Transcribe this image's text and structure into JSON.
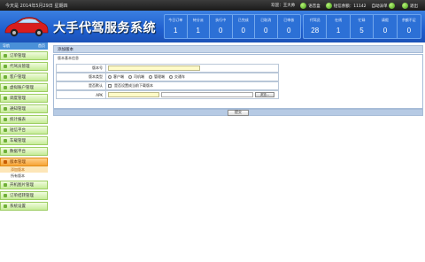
{
  "topbar": {
    "date": "今天是 2014年5月29日 星期四",
    "welcome": "欢迎：王大帅",
    "voice_label": "语音盒",
    "sms_label": "短信余额：11142",
    "auto_dispatch_label": "自动派单",
    "logout_label": "退出"
  },
  "header": {
    "title": "大手代驾服务系统",
    "stats_left": [
      {
        "label": "今日订单",
        "value": "1"
      },
      {
        "label": "待分派",
        "value": "1"
      },
      {
        "label": "执行中",
        "value": "0"
      },
      {
        "label": "已完成",
        "value": "0"
      },
      {
        "label": "已取消",
        "value": "0"
      },
      {
        "label": "已审核",
        "value": "0"
      }
    ],
    "stats_right": [
      {
        "label": "代驾员",
        "value": "28"
      },
      {
        "label": "在线",
        "value": "1"
      },
      {
        "label": "忙碌",
        "value": "5"
      },
      {
        "label": "请假",
        "value": "0"
      },
      {
        "label": "余额不足",
        "value": "0"
      }
    ]
  },
  "sidebar": {
    "head_left": "导航",
    "head_right": "首页",
    "items": [
      {
        "label": "订单管理"
      },
      {
        "label": "代驾员管理"
      },
      {
        "label": "客户管理"
      },
      {
        "label": "虚拟账户管理"
      },
      {
        "label": "调度管理"
      },
      {
        "label": "通知管理"
      },
      {
        "label": "统计报表"
      },
      {
        "label": "短信平台"
      },
      {
        "label": "车载管理"
      },
      {
        "label": "数据平台"
      },
      {
        "label": "版本管理"
      }
    ],
    "subitems": [
      {
        "label": "添加版本"
      },
      {
        "label": "所有版本"
      }
    ],
    "items_after": [
      {
        "label": "开机图片管理"
      },
      {
        "label": "订单结转管理"
      },
      {
        "label": "系统设置"
      }
    ]
  },
  "main": {
    "header": "添加版本",
    "form_title": "版本基本信息",
    "fields": {
      "version_label": "版本号",
      "type_label": "版本类型",
      "type_options": [
        "客户端",
        "司机端",
        "管理端",
        "交通车"
      ],
      "default_label": "是否默认",
      "default_text": "是否设置成当前下载版本",
      "apk_label": "APK",
      "browse_label": "浏览..."
    },
    "submit_label": "提交"
  }
}
